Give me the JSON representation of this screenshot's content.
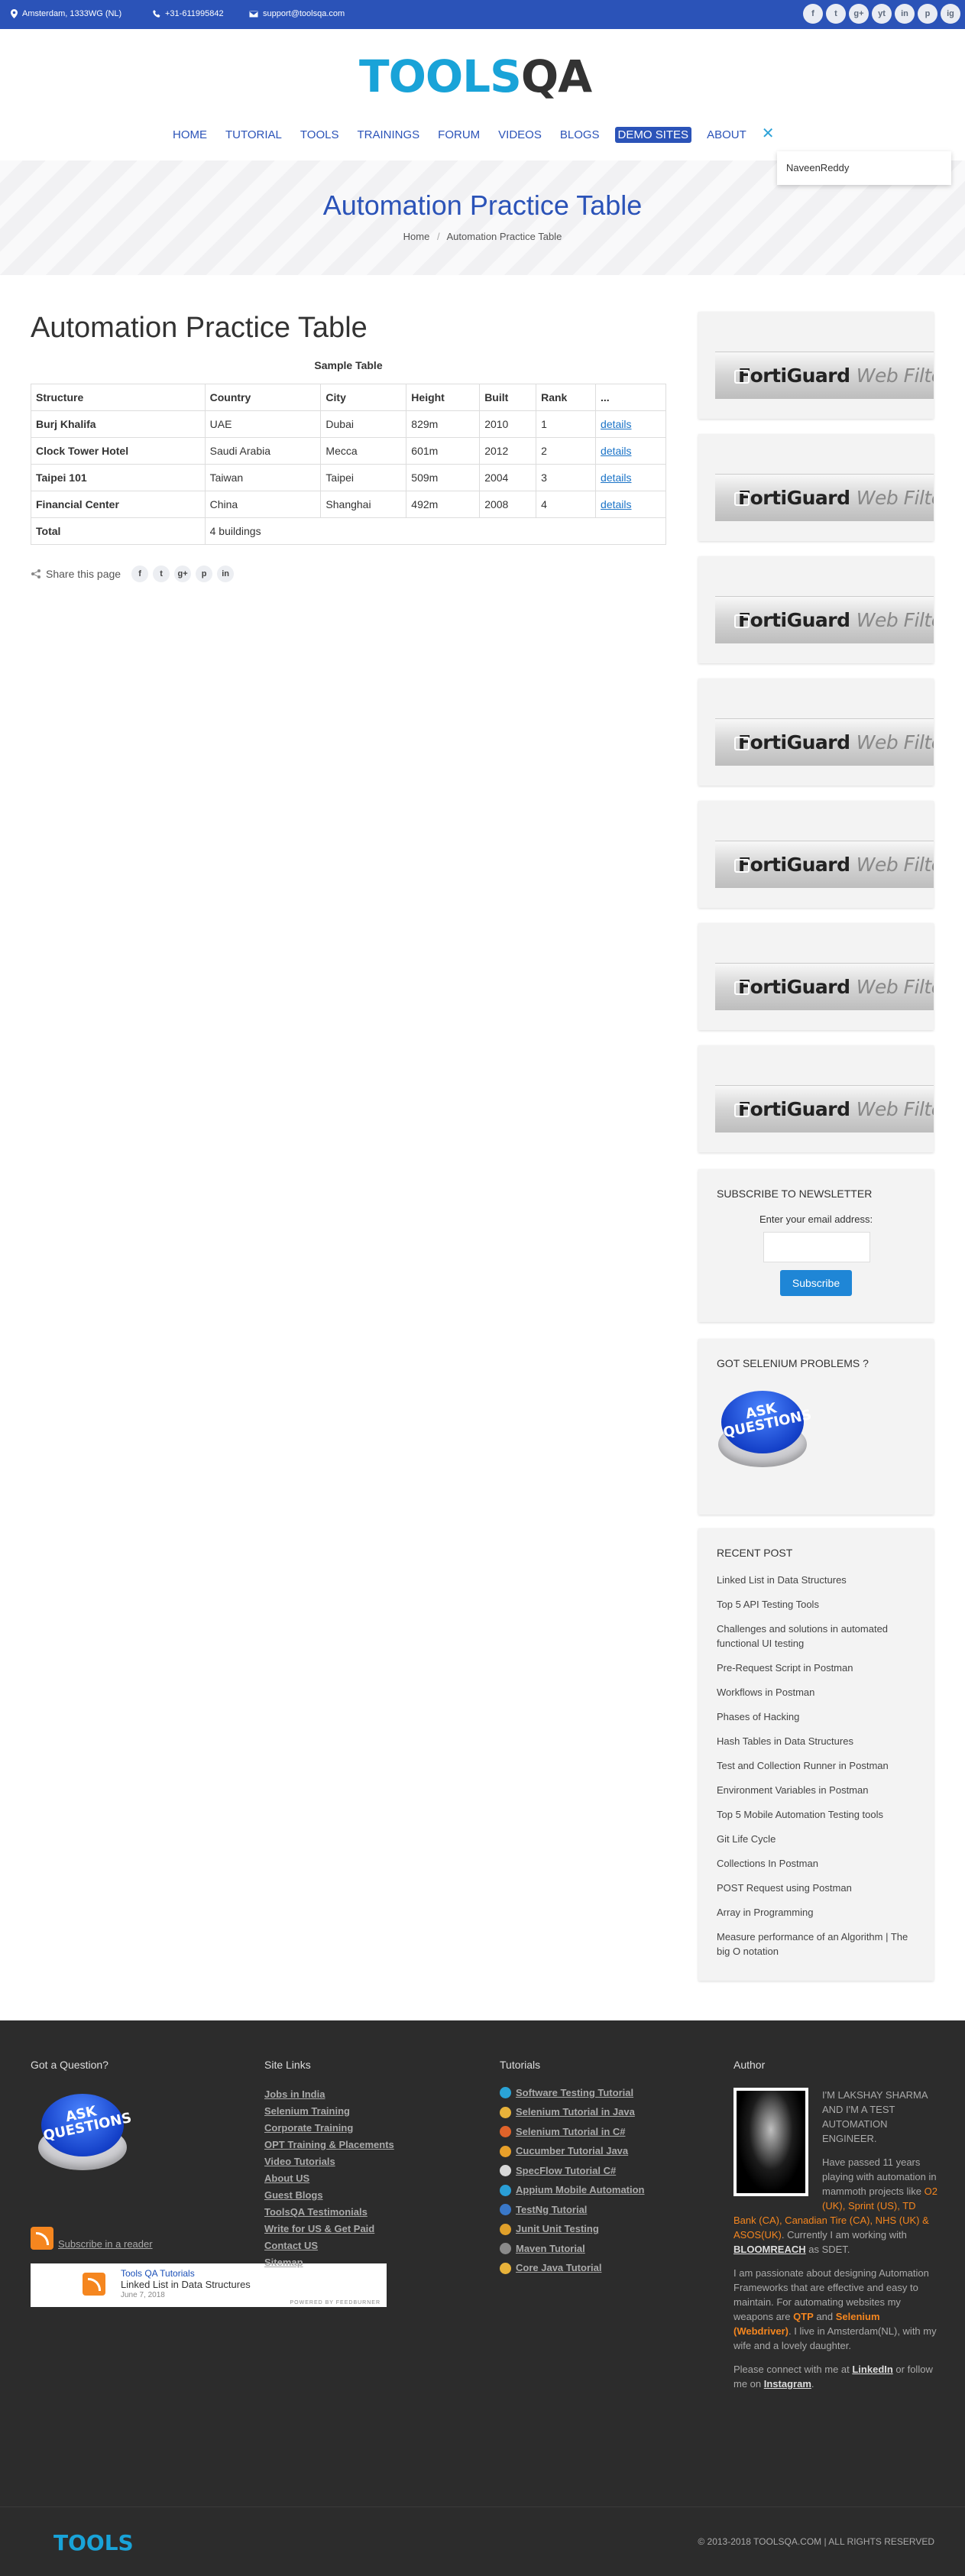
{
  "topbar": {
    "location": "Amsterdam, 1333WG (NL)",
    "phone": "+31-611995842",
    "email": "support@toolsqa.com",
    "social": [
      "f",
      "t",
      "g+",
      "yt",
      "in",
      "p",
      "ig"
    ]
  },
  "logo": {
    "part1": "TOOLS",
    "part2": "QA"
  },
  "nav": {
    "items": [
      "HOME",
      "TUTORIAL",
      "TOOLS",
      "TRAININGS",
      "FORUM",
      "VIDEOS",
      "BLOGS",
      "DEMO SITES",
      "ABOUT"
    ],
    "close": "✕",
    "user": "NaveenReddy"
  },
  "banner": {
    "title": "Automation Practice Table",
    "crumb_home": "Home",
    "crumb_sep": "/",
    "crumb_current": "Automation Practice Table"
  },
  "main": {
    "title": "Automation Practice Table",
    "caption": "Sample Table",
    "headers": [
      "Structure",
      "Country",
      "City",
      "Height",
      "Built",
      "Rank",
      "..."
    ],
    "rows": [
      {
        "structure": "Burj Khalifa",
        "country": "UAE",
        "city": "Dubai",
        "height": "829m",
        "built": "2010",
        "rank": "1",
        "link": "details"
      },
      {
        "structure": "Clock Tower Hotel",
        "country": "Saudi Arabia",
        "city": "Mecca",
        "height": "601m",
        "built": "2012",
        "rank": "2",
        "link": "details"
      },
      {
        "structure": "Taipei 101",
        "country": "Taiwan",
        "city": "Taipei",
        "height": "509m",
        "built": "2004",
        "rank": "3",
        "link": "details"
      },
      {
        "structure": "Financial Center",
        "country": "China",
        "city": "Shanghai",
        "height": "492m",
        "built": "2008",
        "rank": "4",
        "link": "details"
      }
    ],
    "total_label": "Total",
    "total_value": "4 buildings",
    "share_label": "Share this page",
    "share_icons": [
      "f",
      "t",
      "g+",
      "p",
      "in"
    ]
  },
  "sidebar": {
    "ad_brand": "FortiGuard",
    "ad_suffix": "Web Filtering",
    "ad_count": 7,
    "newsletter": {
      "title": "SUBSCRIBE TO NEWSLETTER",
      "label": "Enter your email address:",
      "button": "Subscribe"
    },
    "problems": {
      "title": "GOT SELENIUM PROBLEMS ?",
      "button": "ASK QUESTIONS"
    },
    "recent": {
      "title": "RECENT POST",
      "items": [
        "Linked List in Data Structures",
        "Top 5 API Testing Tools",
        "Challenges and solutions in automated functional UI testing",
        "Pre-Request Script in Postman",
        "Workflows in Postman",
        "Phases of Hacking",
        "Hash Tables in Data Structures",
        "Test and Collection Runner in Postman",
        "Environment Variables in Postman",
        "Top 5 Mobile Automation Testing tools",
        "Git Life Cycle",
        "Collections In Postman",
        "POST Request using Postman",
        "Array in Programming",
        "Measure performance of an Algorithm | The big O notation"
      ]
    }
  },
  "footer": {
    "question": {
      "title": "Got a Question?",
      "button": "ASK QUESTIONS",
      "rss": "Subscribe in a reader"
    },
    "feed": {
      "source": "Tools QA Tutorials",
      "headline": "Linked List in Data Structures",
      "date": "June 7, 2018",
      "powered": "POWERED BY FEEDBURNER"
    },
    "site_links": {
      "title": "Site Links",
      "items": [
        "Jobs in India",
        "Selenium Training",
        "Corporate Training",
        "OPT Training & Placements",
        "Video Tutorials",
        "About US",
        "Guest Blogs",
        "ToolsQA Testimonials",
        "Write for US & Get Paid",
        "Contact US",
        "Sitemap"
      ]
    },
    "tutorials": {
      "title": "Tutorials",
      "items": [
        {
          "label": "Software Testing Tutorial",
          "color": "#2aa3d6"
        },
        {
          "label": "Selenium Tutorial in Java",
          "color": "#e8b23a"
        },
        {
          "label": "Selenium Tutorial in C#",
          "color": "#e0632a"
        },
        {
          "label": "Cucumber Tutorial Java",
          "color": "#e8a02a"
        },
        {
          "label": "SpecFlow Tutorial C#",
          "color": "#d8d8d8"
        },
        {
          "label": "Appium Mobile Automation",
          "color": "#2a9ed6"
        },
        {
          "label": "TestNg Tutorial",
          "color": "#3a78c8"
        },
        {
          "label": "Junit Unit Testing",
          "color": "#e0a02a"
        },
        {
          "label": "Maven Tutorial",
          "color": "#8a8a8a"
        },
        {
          "label": "Core Java Tutorial",
          "color": "#e8b23a"
        }
      ]
    },
    "author": {
      "title": "Author",
      "intro": "I'M LAKSHAY SHARMA AND I'M A TEST AUTOMATION ENGINEER.",
      "p1_a": "Have passed 11 years playing with automation in mammoth projects like ",
      "p1_b": "O2 (UK), Sprint (US), TD Bank (CA), Canadian Tire (CA), NHS (UK) & ASOS(UK)",
      "p1_c": ". Currently I am working with ",
      "p1_d": "BLOOMREACH",
      "p1_e": " as SDET.",
      "p2_a": "I am passionate about designing Automation Frameworks that are effective and easy to maintain. For automating websites my weapons are ",
      "p2_b": "QTP",
      "p2_c": " and ",
      "p2_d": "Selenium (Webdriver)",
      "p2_e": ". I live in Amsterdam(NL), with my wife and a lovely daughter.",
      "p3_a": "Please connect with me at ",
      "p3_b": "LinkedIn",
      "p3_c": " or follow me on ",
      "p3_d": "Instagram",
      "p3_e": "."
    },
    "logo": "TOOLS",
    "copyright": "© 2013-2018 TOOLSQA.COM | ALL RIGHTS RESERVED"
  }
}
